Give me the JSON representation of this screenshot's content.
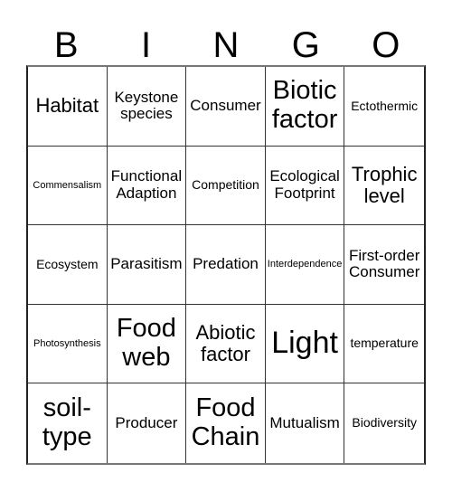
{
  "header": {
    "letters": [
      "B",
      "I",
      "N",
      "G",
      "O"
    ]
  },
  "board": {
    "cells": [
      {
        "text": "Habitat",
        "size": "lg"
      },
      {
        "text": "Keystone species",
        "size": "md"
      },
      {
        "text": "Consumer",
        "size": "md"
      },
      {
        "text": "Biotic factor",
        "size": "xl"
      },
      {
        "text": "Ectothermic",
        "size": "sm"
      },
      {
        "text": "Commensalism",
        "size": "xs"
      },
      {
        "text": "Functional Adaption",
        "size": "md"
      },
      {
        "text": "Competition",
        "size": "sm"
      },
      {
        "text": "Ecological Footprint",
        "size": "md"
      },
      {
        "text": "Trophic level",
        "size": "lg"
      },
      {
        "text": "Ecosystem",
        "size": "sm"
      },
      {
        "text": "Parasitism",
        "size": "md"
      },
      {
        "text": "Predation",
        "size": "md"
      },
      {
        "text": "Interdependence",
        "size": "xs"
      },
      {
        "text": "First-order Consumer",
        "size": "md"
      },
      {
        "text": "Photosynthesis",
        "size": "xs"
      },
      {
        "text": "Food web",
        "size": "xl"
      },
      {
        "text": "Abiotic factor",
        "size": "lg"
      },
      {
        "text": "Light",
        "size": "xxl"
      },
      {
        "text": "temperature",
        "size": "sm"
      },
      {
        "text": "soil-type",
        "size": "xl"
      },
      {
        "text": "Producer",
        "size": "md"
      },
      {
        "text": "Food Chain",
        "size": "xl"
      },
      {
        "text": "Mutualism",
        "size": "md"
      },
      {
        "text": "Biodiversity",
        "size": "sm"
      }
    ]
  }
}
